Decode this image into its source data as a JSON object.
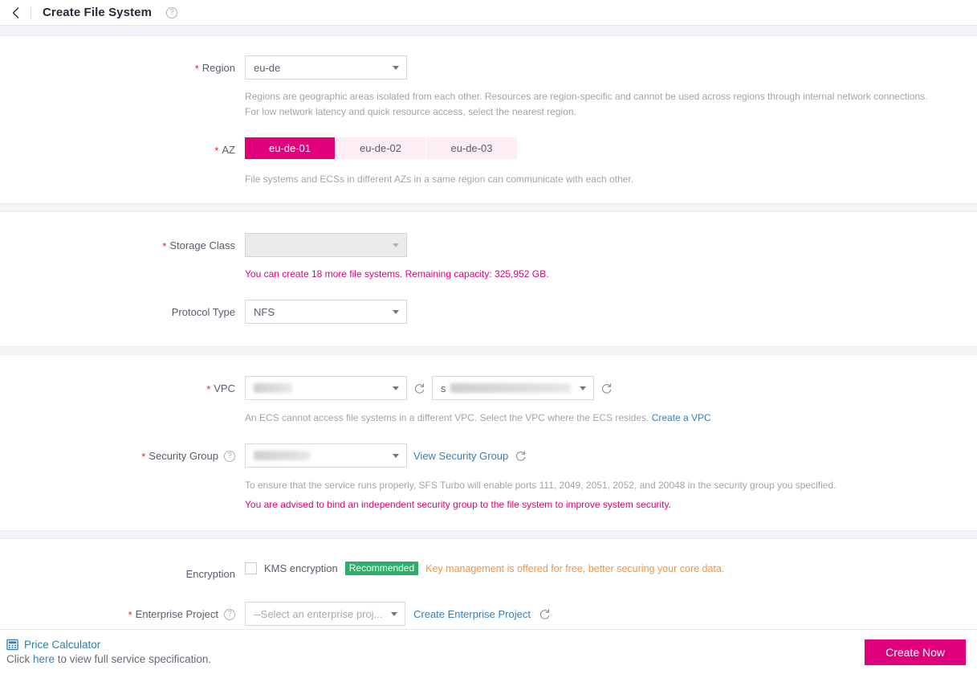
{
  "header": {
    "back_icon": "chevron-left-icon",
    "title": "Create File System",
    "help_icon": "help-circle-icon"
  },
  "form": {
    "region": {
      "label": "Region",
      "required": true,
      "value": "eu-de",
      "hint_line1": "Regions are geographic areas isolated from each other. Resources are region-specific and cannot be used across regions through internal network connections.",
      "hint_line2": "For low network latency and quick resource access, select the nearest region."
    },
    "az": {
      "label": "AZ",
      "required": true,
      "options": [
        "eu-de-01",
        "eu-de-02",
        "eu-de-03"
      ],
      "selected": "eu-de-01",
      "hint": "File systems and ECSs in different AZs in a same region can communicate with each other."
    },
    "storage_class": {
      "label": "Storage Class",
      "required": true,
      "value": "",
      "disabled": true,
      "capacity_note": "You can create 18 more file systems. Remaining capacity: 325,952 GB."
    },
    "protocol_type": {
      "label": "Protocol Type",
      "required": false,
      "value": "NFS"
    },
    "vpc": {
      "label": "VPC",
      "required": true,
      "value": "",
      "subnet_value": "s",
      "redacted": true,
      "refresh_icon": "refresh-icon",
      "hint": "An ECS cannot access file systems in a different VPC. Select the VPC where the ECS resides.",
      "hint_link": "Create a VPC"
    },
    "security_group": {
      "label": "Security Group",
      "required": true,
      "help_icon": "help-circle-icon",
      "value": "",
      "redacted": true,
      "view_link": "View Security Group",
      "refresh_icon": "refresh-icon",
      "hint": "To ensure that the service runs properly, SFS Turbo will enable ports 111, 2049, 2051, 2052, and 20048 in the security group you specified.",
      "warn": "You are advised to bind an independent security group to the file system to improve system security."
    },
    "encryption": {
      "label": "Encryption",
      "required": false,
      "checkbox_label": "KMS encryption",
      "checked": false,
      "badge": "Recommended",
      "badge_color": "#2cae6c",
      "note": "Key management is offered for free, better securing your core data."
    },
    "enterprise_project": {
      "label": "Enterprise Project",
      "required": true,
      "help_icon": "help-circle-icon",
      "placeholder": "--Select an enterprise proj...",
      "value": "--Select an enterprise proj...",
      "create_link": "Create Enterprise Project",
      "refresh_icon": "refresh-icon"
    }
  },
  "footer": {
    "calculator_icon": "calculator-icon",
    "calculator_label": "Price Calculator",
    "spec_prefix": "Click ",
    "spec_link": "here",
    "spec_suffix": " to view full service specification.",
    "create_button": "Create Now"
  },
  "colors": {
    "accent": "#e1007b",
    "link": "#3a7fb4",
    "green": "#2cae6c",
    "orange": "#f7923b",
    "required_star": "#e32020"
  }
}
